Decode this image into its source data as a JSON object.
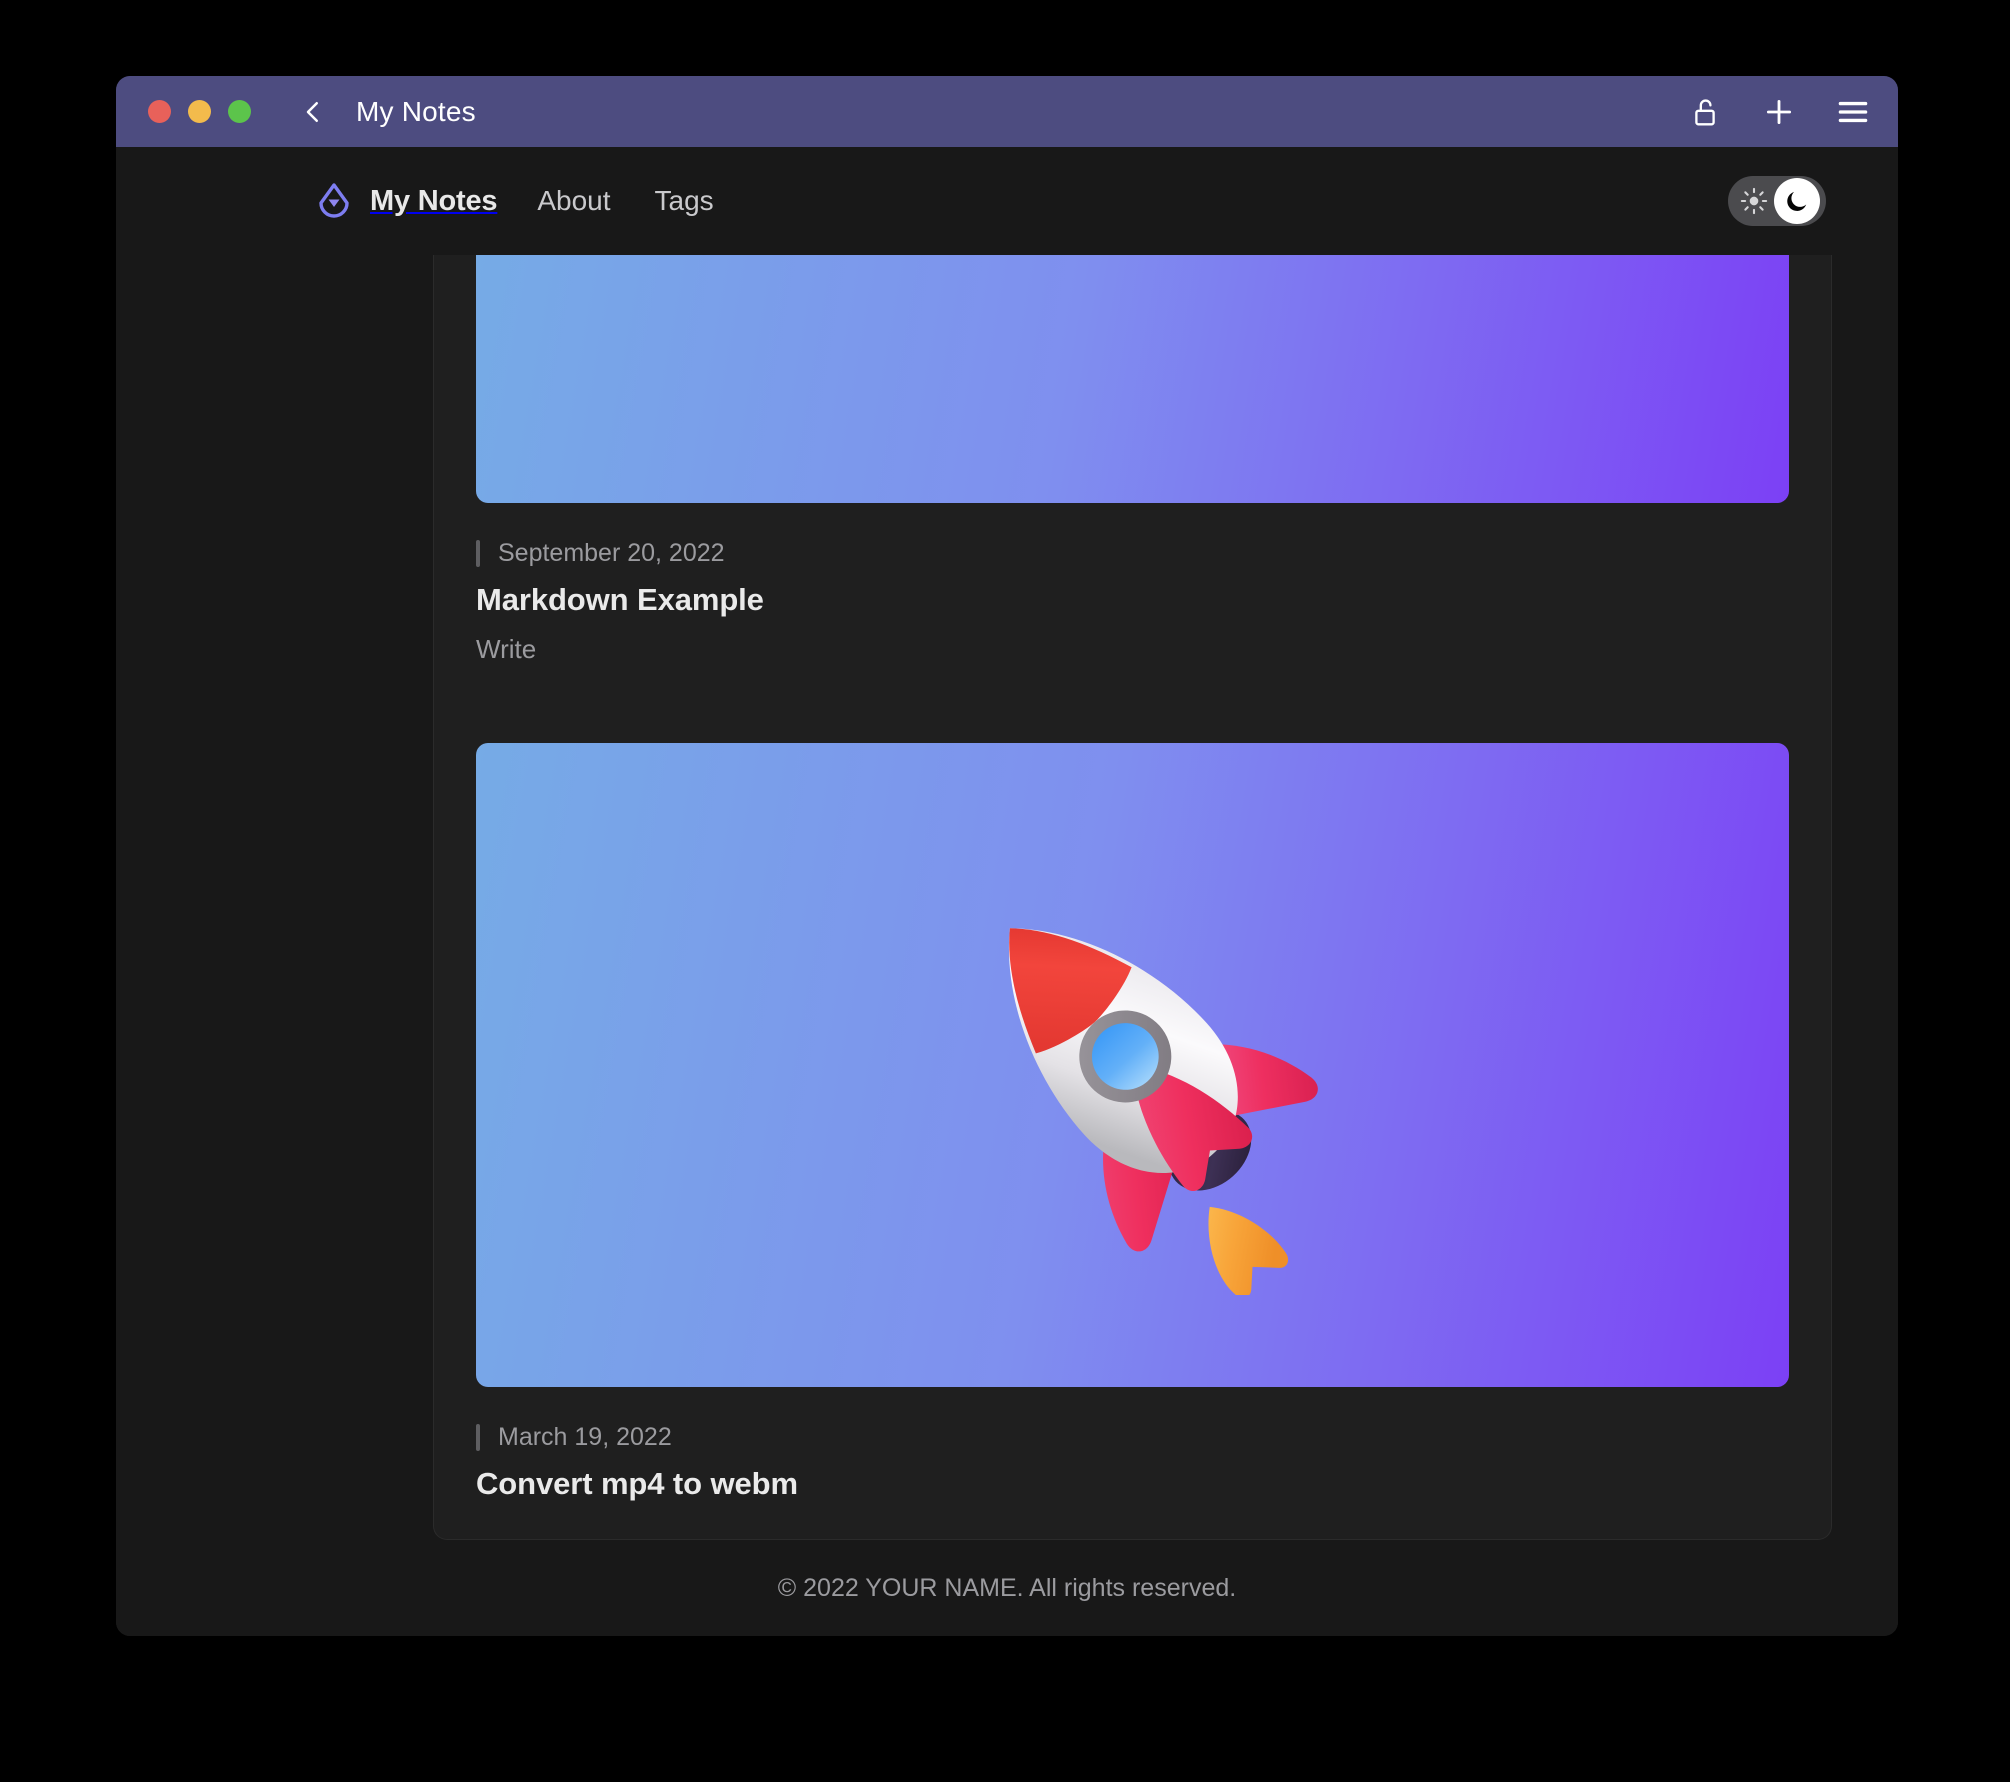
{
  "window": {
    "title": "My Notes",
    "traffic_lights": [
      {
        "name": "close",
        "color": "#e8615a"
      },
      {
        "name": "minimize",
        "color": "#f3bb4c"
      },
      {
        "name": "maximize",
        "color": "#5cc44b"
      }
    ],
    "titlebar_color": "#4d4c80",
    "back_icon": "chevron-left-icon",
    "actions": [
      {
        "name": "unlock-icon",
        "label": "Unlock"
      },
      {
        "name": "plus-icon",
        "label": "New note"
      },
      {
        "name": "hamburger-menu-icon",
        "label": "Menu"
      }
    ]
  },
  "navbar": {
    "logo_icon": "teardrop-logo-icon",
    "brand": "My Notes",
    "links": [
      {
        "label": "About"
      },
      {
        "label": "Tags"
      }
    ],
    "theme_toggle": {
      "sun_icon": "sun-icon",
      "moon_icon": "moon-icon",
      "state": "dark"
    }
  },
  "notes": [
    {
      "date": "September 20, 2022",
      "title": "Markdown Example",
      "subtitle": "Write",
      "thumb": {
        "kind": "gradient",
        "clipped": true,
        "emoji": ""
      }
    },
    {
      "date": "March 19, 2022",
      "title": "Convert mp4 to webm",
      "subtitle": "",
      "thumb": {
        "kind": "gradient",
        "clipped": false,
        "emoji": "rocket-emoji"
      }
    }
  ],
  "footer": {
    "text": "© 2022 YOUR NAME. All rights reserved."
  },
  "colors": {
    "page_background": "#181818",
    "panel_background": "#1f1f1f",
    "titlebar": "#4d4c80",
    "accent_logo": "#7d7df0",
    "gradient_start": "#76abe6",
    "gradient_end": "#7c40f5",
    "muted_text": "#9b9b9f",
    "title_text": "#eaeaea"
  }
}
